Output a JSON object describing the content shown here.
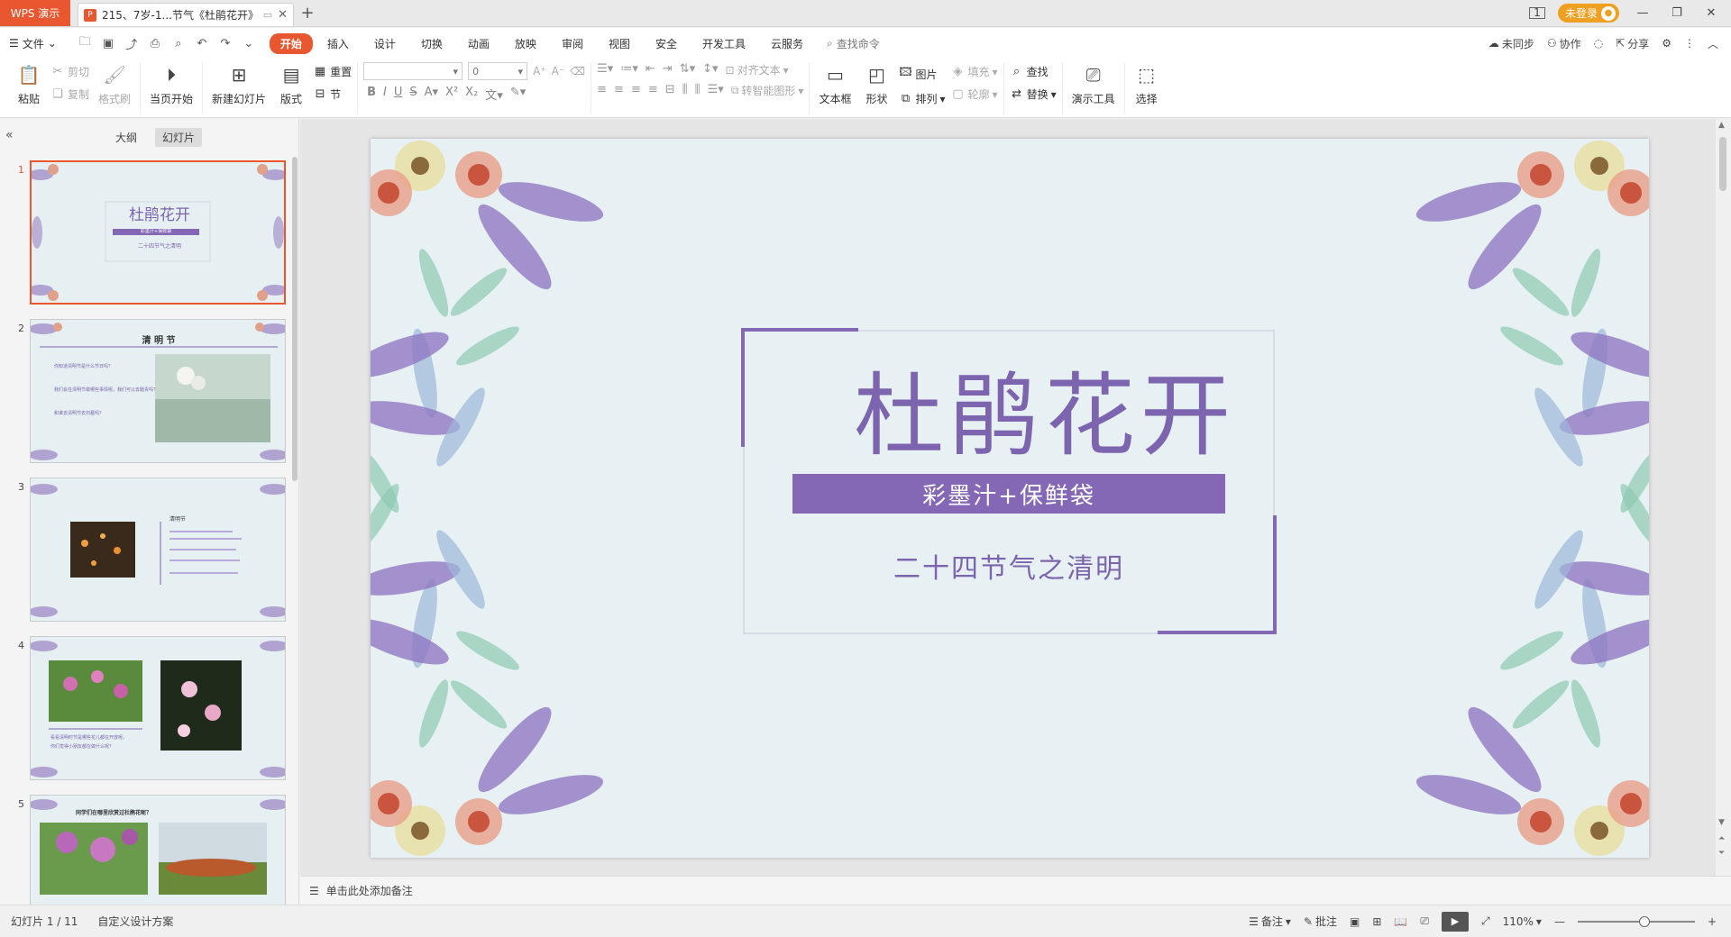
{
  "titlebar": {
    "app_name": "WPS 演示",
    "doc_title": "215、7岁-1...节气《杜鹃花开》",
    "login_label": "未登录"
  },
  "menubar": {
    "file_label": "文件",
    "tabs": [
      "开始",
      "插入",
      "设计",
      "切换",
      "动画",
      "放映",
      "审阅",
      "视图",
      "安全",
      "开发工具",
      "云服务"
    ],
    "active_tab": "开始",
    "search_placeholder": "查找命令",
    "right": {
      "sync": "未同步",
      "collab": "协作",
      "share": "分享"
    }
  },
  "ribbon": {
    "paste": "粘贴",
    "cut": "剪切",
    "copy": "复制",
    "format_painter": "格式刷",
    "play_from_current": "当页开始",
    "new_slide": "新建幻灯片",
    "layout": "版式",
    "reset": "重置",
    "section": "节",
    "font_size_value": "0",
    "align_text": "对齐文本",
    "convert_smartart": "转智能图形",
    "textbox": "文本框",
    "shape": "形状",
    "picture": "图片",
    "arrange": "排列",
    "fill": "填充",
    "outline": "轮廓",
    "find": "查找",
    "replace": "替换",
    "presentation_tools": "演示工具",
    "select": "选择"
  },
  "leftpanel": {
    "tab_outline": "大纲",
    "tab_slides": "幻灯片",
    "slides": [
      {
        "num": "1",
        "title": "杜鹃花开",
        "band": "彩墨汁+保鲜袋",
        "sub": "二十四节气之清明"
      },
      {
        "num": "2",
        "title": "清 明 节",
        "lines": [
          "你知道清明节是什么节日吗？",
          "我们会在清明节做哪些事情呢，我们可以去踏青吗？",
          "和谁去清明节去扫墓吗？"
        ]
      },
      {
        "num": "3",
        "title": "清明节"
      },
      {
        "num": "4",
        "lines": [
          "看看清明时节是哪些花儿都在开放呢，",
          "你们觉得小朋友都在做什么呢？"
        ]
      },
      {
        "num": "5",
        "title": "同学们在哪里欣赏过杜鹃花呢？"
      }
    ]
  },
  "slide": {
    "title": "杜鹃花开",
    "band": "彩墨汁+保鲜袋",
    "subtitle": "二十四节气之清明",
    "accent": "#8468b6",
    "background": "#e7f0f3"
  },
  "notes": {
    "placeholder": "单击此处添加备注"
  },
  "statusbar": {
    "slide_info": "幻灯片 1 / 11",
    "design": "自定义设计方案",
    "notes_btn": "备注",
    "comments_btn": "批注",
    "zoom": "110%"
  }
}
